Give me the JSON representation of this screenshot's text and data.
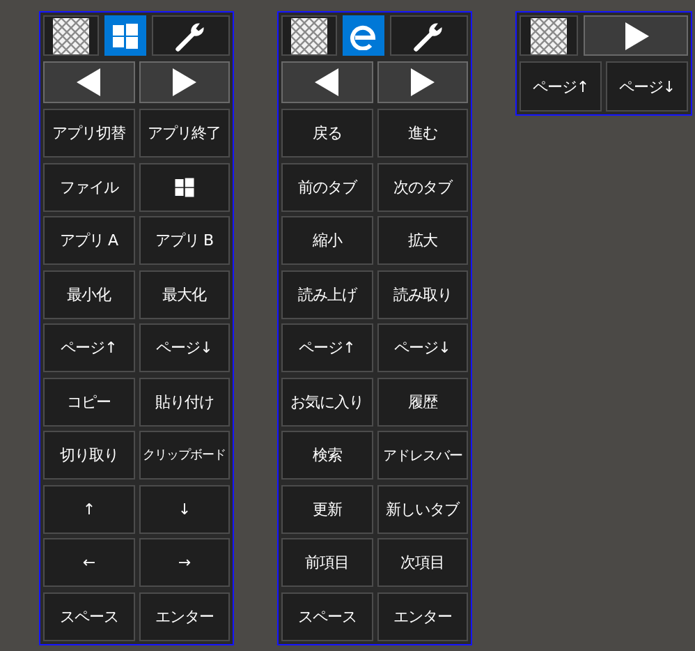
{
  "panels": [
    {
      "header": [
        {
          "kind": "pattern",
          "selected": false
        },
        {
          "kind": "windows",
          "selected": true
        },
        {
          "kind": "wrench",
          "selected": false
        }
      ],
      "nav": [
        {
          "kind": "prev"
        },
        {
          "kind": "next"
        }
      ],
      "keys": [
        {
          "kind": "text",
          "label": "アプリ切替"
        },
        {
          "kind": "text",
          "label": "アプリ終了"
        },
        {
          "kind": "text",
          "label": "ファイル"
        },
        {
          "kind": "windows-logo"
        },
        {
          "kind": "text",
          "label": "アプリ A"
        },
        {
          "kind": "text",
          "label": "アプリ B"
        },
        {
          "kind": "text",
          "label": "最小化"
        },
        {
          "kind": "text",
          "label": "最大化"
        },
        {
          "kind": "text",
          "label": "ページ↑"
        },
        {
          "kind": "text",
          "label": "ページ↓"
        },
        {
          "kind": "text",
          "label": "コピー"
        },
        {
          "kind": "text",
          "label": "貼り付け"
        },
        {
          "kind": "text",
          "label": "切り取り"
        },
        {
          "kind": "text",
          "label": "クリップボード"
        },
        {
          "kind": "text",
          "label": "↑"
        },
        {
          "kind": "text",
          "label": "↓"
        },
        {
          "kind": "text",
          "label": "←"
        },
        {
          "kind": "text",
          "label": "→"
        },
        {
          "kind": "text",
          "label": "スペース"
        },
        {
          "kind": "text",
          "label": "エンター"
        }
      ]
    },
    {
      "header": [
        {
          "kind": "pattern",
          "selected": false
        },
        {
          "kind": "edge",
          "selected": true
        },
        {
          "kind": "wrench",
          "selected": false
        }
      ],
      "nav": [
        {
          "kind": "prev"
        },
        {
          "kind": "next"
        }
      ],
      "keys": [
        {
          "kind": "text",
          "label": "戻る"
        },
        {
          "kind": "text",
          "label": "進む"
        },
        {
          "kind": "text",
          "label": "前のタブ"
        },
        {
          "kind": "text",
          "label": "次のタブ"
        },
        {
          "kind": "text",
          "label": "縮小"
        },
        {
          "kind": "text",
          "label": "拡大"
        },
        {
          "kind": "text",
          "label": "読み上げ"
        },
        {
          "kind": "text",
          "label": "読み取り"
        },
        {
          "kind": "text",
          "label": "ページ↑"
        },
        {
          "kind": "text",
          "label": "ページ↓"
        },
        {
          "kind": "text",
          "label": "お気に入り"
        },
        {
          "kind": "text",
          "label": "履歴"
        },
        {
          "kind": "text",
          "label": "検索"
        },
        {
          "kind": "text",
          "label": "アドレスバー"
        },
        {
          "kind": "text",
          "label": "更新"
        },
        {
          "kind": "text",
          "label": "新しいタブ"
        },
        {
          "kind": "text",
          "label": "前項目"
        },
        {
          "kind": "text",
          "label": "次項目"
        },
        {
          "kind": "text",
          "label": "スペース"
        },
        {
          "kind": "text",
          "label": "エンター"
        }
      ]
    },
    {
      "header": [
        {
          "kind": "pattern",
          "selected": false
        },
        {
          "kind": "next",
          "selected": false
        }
      ],
      "keys": [
        {
          "kind": "text",
          "label": "ページ↑"
        },
        {
          "kind": "text",
          "label": "ページ↓"
        }
      ]
    }
  ]
}
